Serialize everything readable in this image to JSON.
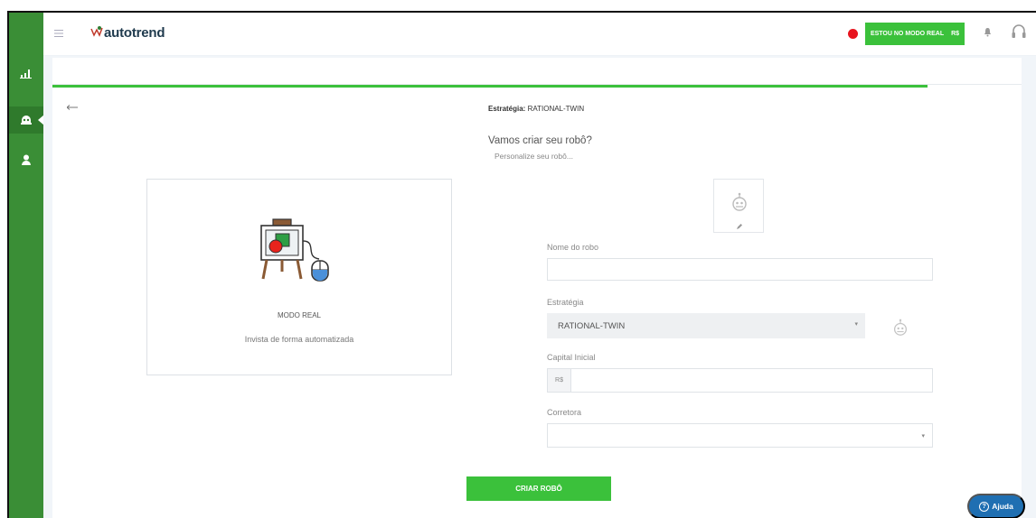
{
  "header": {
    "logo_text": "autotrend",
    "mode_button_label": "ESTOU NO MODO REAL",
    "mode_button_badge": "R$"
  },
  "sidebar": {
    "items": [
      {
        "icon": "bar-chart-icon",
        "active": false
      },
      {
        "icon": "robot-icon",
        "active": true
      },
      {
        "icon": "user-icon",
        "active": false
      }
    ]
  },
  "page": {
    "strategy_label": "Estratégia:",
    "strategy_value": "RATIONAL-TWIN",
    "heading": "Vamos criar seu robô?",
    "subheading": "Personalize seu robô..."
  },
  "card": {
    "title": "MODO REAL",
    "description": "Invista de forma automatizada"
  },
  "form": {
    "name_label": "Nome do robo",
    "name_value": "",
    "strategy_label": "Estratégia",
    "strategy_selected": "RATIONAL-TWIN",
    "capital_label": "Capital Inicial",
    "capital_prefix": "R$",
    "capital_value": "",
    "broker_label": "Corretora",
    "broker_selected": "",
    "submit_label": "CRIAR ROBÔ"
  },
  "help": {
    "label": "Ajuda"
  },
  "colors": {
    "sidebar": "#3a8e36",
    "accent": "#3bc13b",
    "recording_dot": "#e8141e",
    "help": "#1f6fb2"
  }
}
